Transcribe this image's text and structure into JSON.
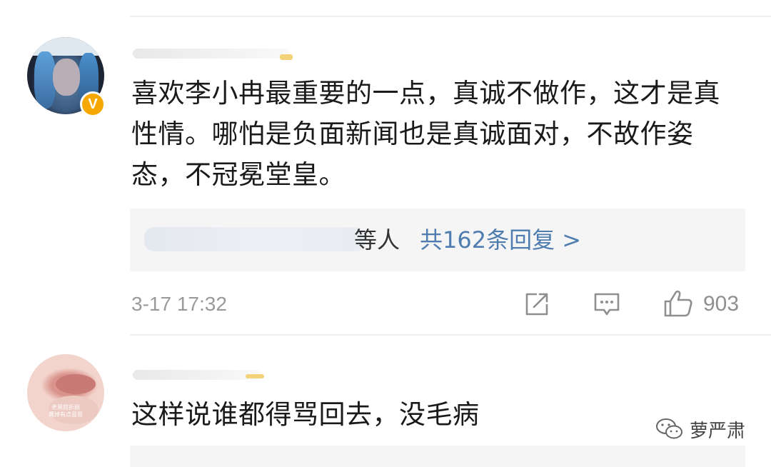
{
  "comments": [
    {
      "text_lines": [
        "喜欢李小冉最重要的一点，真诚不做作，这才是真",
        "性情。哪怕是负面新闻也是真诚面对，不故作姿",
        "态，不冠冕堂皇。"
      ],
      "verified_badge": "V",
      "reply_suffix": "等人",
      "reply_link": "共162条回复 >",
      "timestamp": "3-17 17:32",
      "likes": "903"
    },
    {
      "text_lines": [
        "这样说谁都得骂回去，没毛病"
      ],
      "avatar_caption": [
        "老黑防折损",
        "鹰掉有点意思"
      ]
    }
  ],
  "watermark": "萝严肃",
  "icons": {
    "share": "share-icon",
    "comment": "comment-icon",
    "like": "thumbs-up-icon",
    "wechat": "wechat-icon"
  },
  "colors": {
    "link": "#507daf",
    "badge": "#f6a800",
    "meta": "#9a9a9a"
  }
}
